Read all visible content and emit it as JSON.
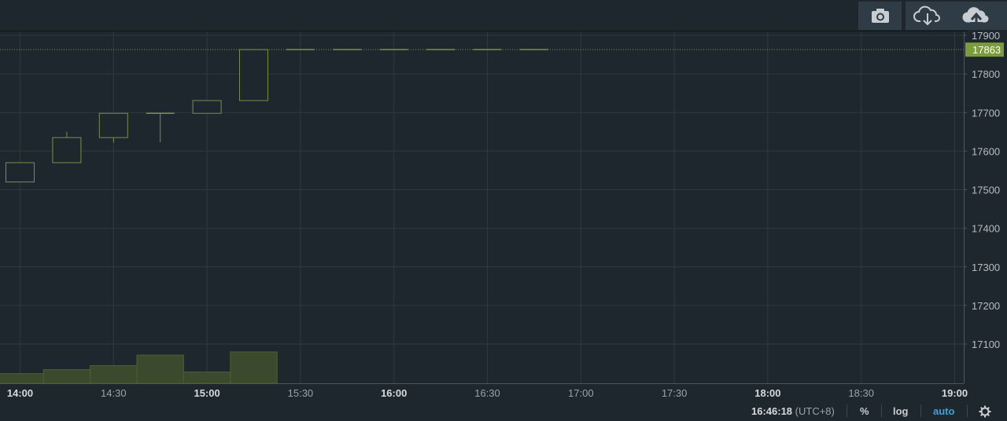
{
  "toolbar": {
    "buttons": [
      {
        "name": "screenshot",
        "icon": "camera-icon"
      },
      {
        "name": "download",
        "icon": "cloud-download-icon"
      },
      {
        "name": "upload",
        "icon": "cloud-upload-icon"
      }
    ]
  },
  "colors": {
    "background": "#1f272e",
    "grid": "#2d3942",
    "candle": "#7a8f46",
    "volume_fill": "#3b4a2c",
    "volume_stroke": "#4d5e36",
    "last_price_badge": "#7a9c3a",
    "accent": "#3aa3d8"
  },
  "chart_data": {
    "type": "candlestick",
    "y_ticks": [
      17100,
      17200,
      17300,
      17400,
      17500,
      17600,
      17700,
      17800,
      17900
    ],
    "ylim": [
      17000,
      17910
    ],
    "x_ticks": [
      {
        "t": 840,
        "label": "14:00",
        "bold": true
      },
      {
        "t": 870,
        "label": "14:30",
        "bold": false
      },
      {
        "t": 900,
        "label": "15:00",
        "bold": true
      },
      {
        "t": 930,
        "label": "15:30",
        "bold": false
      },
      {
        "t": 960,
        "label": "16:00",
        "bold": true
      },
      {
        "t": 990,
        "label": "16:30",
        "bold": false
      },
      {
        "t": 1020,
        "label": "17:00",
        "bold": false
      },
      {
        "t": 1050,
        "label": "17:30",
        "bold": false
      },
      {
        "t": 1080,
        "label": "18:00",
        "bold": true
      },
      {
        "t": 1110,
        "label": "18:30",
        "bold": false
      },
      {
        "t": 1140,
        "label": "19:00",
        "bold": true
      }
    ],
    "interval_minutes": 15,
    "candles": [
      {
        "t": 840,
        "open": 17520,
        "high": 17570,
        "low": 17520,
        "close": 17570
      },
      {
        "t": 855,
        "open": 17570,
        "high": 17650,
        "low": 17570,
        "close": 17635
      },
      {
        "t": 870,
        "open": 17635,
        "high": 17698,
        "low": 17622,
        "close": 17698
      },
      {
        "t": 885,
        "open": 17698,
        "high": 17698,
        "low": 17623,
        "close": 17698
      },
      {
        "t": 900,
        "open": 17698,
        "high": 17731,
        "low": 17698,
        "close": 17731
      },
      {
        "t": 915,
        "open": 17731,
        "high": 17863,
        "low": 17731,
        "close": 17863
      },
      {
        "t": 930,
        "open": 17863,
        "high": 17863,
        "low": 17863,
        "close": 17863
      },
      {
        "t": 945,
        "open": 17863,
        "high": 17863,
        "low": 17863,
        "close": 17863
      },
      {
        "t": 960,
        "open": 17863,
        "high": 17863,
        "low": 17863,
        "close": 17863
      },
      {
        "t": 975,
        "open": 17863,
        "high": 17863,
        "low": 17863,
        "close": 17863
      },
      {
        "t": 990,
        "open": 17863,
        "high": 17863,
        "low": 17863,
        "close": 17863
      },
      {
        "t": 1005,
        "open": 17863,
        "high": 17863,
        "low": 17863,
        "close": 17863
      }
    ],
    "volume": [
      {
        "t": 840,
        "v": 12
      },
      {
        "t": 855,
        "v": 17
      },
      {
        "t": 870,
        "v": 22
      },
      {
        "t": 885,
        "v": 35
      },
      {
        "t": 900,
        "v": 14
      },
      {
        "t": 915,
        "v": 39
      }
    ],
    "last_price": 17863,
    "last_price_label": "17863",
    "grid": true
  },
  "footer": {
    "time": "16:46:18",
    "timezone": "(UTC+8)",
    "percent_label": "%",
    "log_label": "log",
    "auto_label": "auto"
  }
}
